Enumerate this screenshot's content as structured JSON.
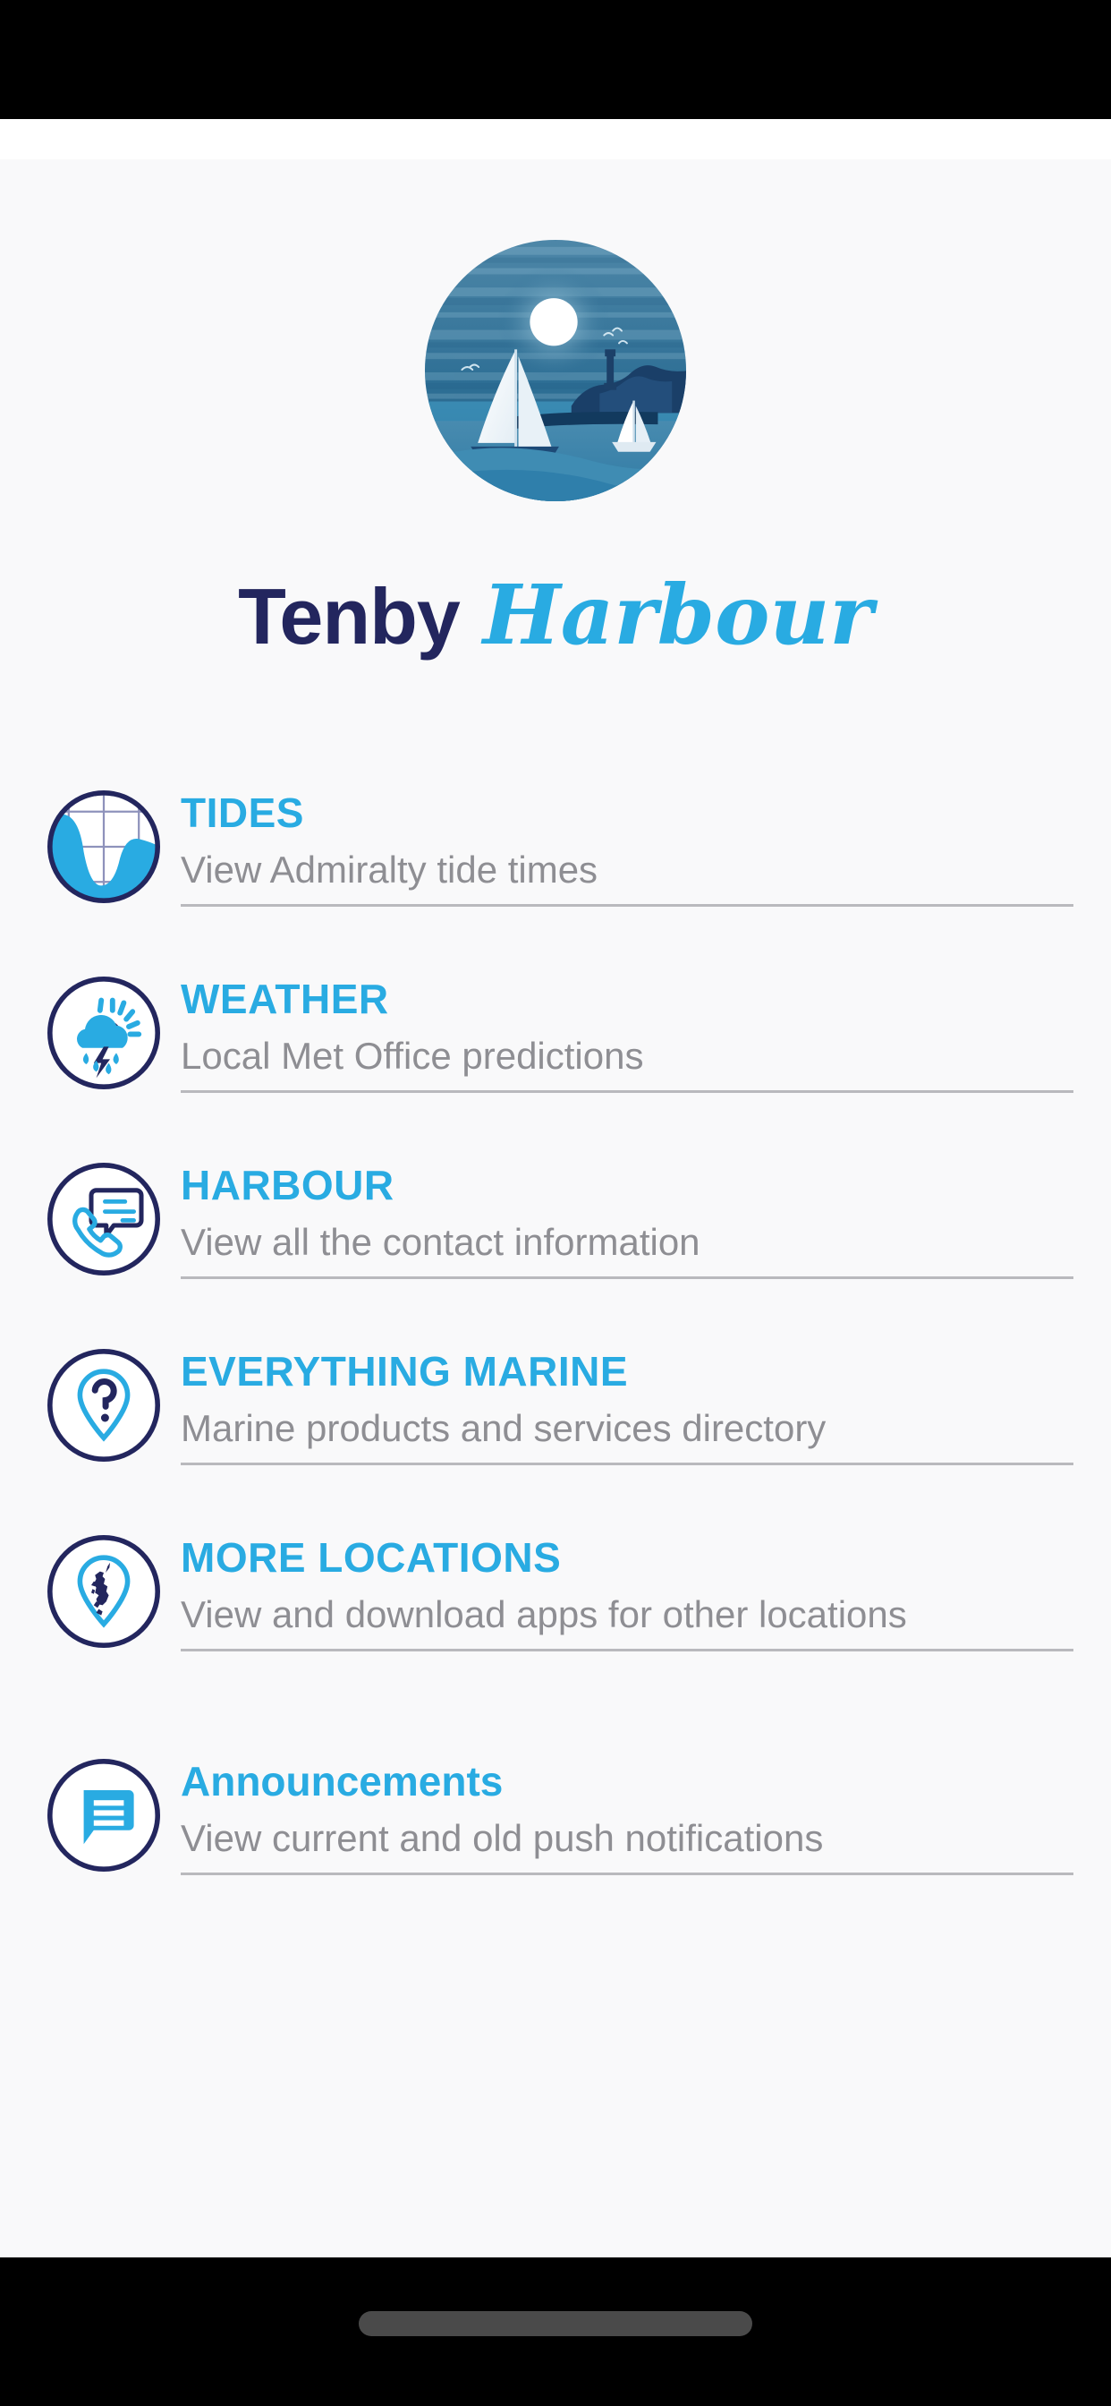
{
  "app": {
    "title_primary": "Tenby",
    "title_secondary": "Harbour",
    "logo_name": "tenby-harbour-logo"
  },
  "colors": {
    "accent_blue": "#29ABE2",
    "navy": "#23265e",
    "description_gray": "#8e8e93",
    "divider_gray": "#b9b9bd",
    "background": "#f9f9fa",
    "system_bar": "#000000",
    "home_indicator": "#4a4a4a"
  },
  "menu": {
    "items": [
      {
        "id": "tides",
        "icon": "tide-chart-icon",
        "title": "TIDES",
        "description": "View Admiralty tide times"
      },
      {
        "id": "weather",
        "icon": "storm-cloud-sun-icon",
        "title": "WEATHER",
        "description": "Local Met Office predictions"
      },
      {
        "id": "harbour",
        "icon": "phone-message-icon",
        "title": "HARBOUR",
        "description": "View all the contact information"
      },
      {
        "id": "everything-marine",
        "icon": "map-pin-question-icon",
        "title": "EVERYTHING MARINE",
        "description": "Marine products and services directory"
      },
      {
        "id": "more-locations",
        "icon": "map-pin-uk-icon",
        "title": "MORE LOCATIONS",
        "description": "View and download apps for other locations"
      },
      {
        "id": "announcements",
        "icon": "speech-bubble-lines-icon",
        "title": "Announcements",
        "description": "View current and old push notifications"
      }
    ]
  }
}
